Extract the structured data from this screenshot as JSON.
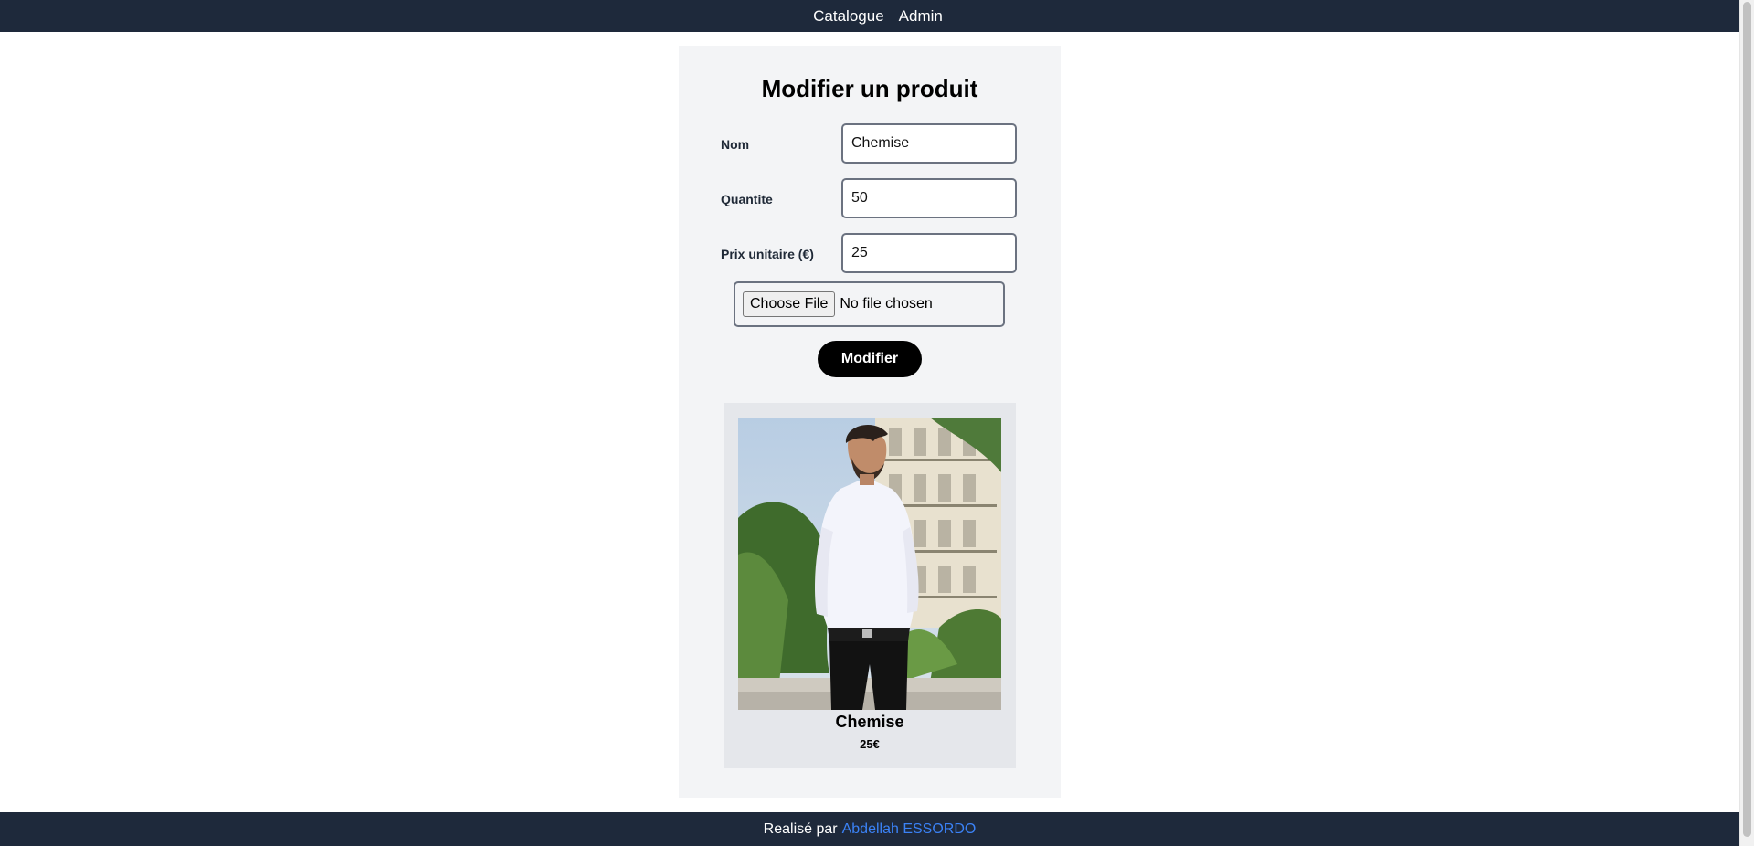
{
  "nav": {
    "items": [
      {
        "label": "Catalogue"
      },
      {
        "label": "Admin"
      }
    ]
  },
  "form": {
    "title": "Modifier un produit",
    "fields": [
      {
        "label": "Nom",
        "value": "Chemise"
      },
      {
        "label": "Quantite",
        "value": "50"
      },
      {
        "label": "Prix unitaire (€)",
        "value": "25"
      }
    ],
    "file_input": {
      "button_label": "Choose File",
      "status": "No file chosen"
    },
    "submit_label": "Modifier"
  },
  "preview": {
    "image_icon": "product-photo-shirt",
    "name": "Chemise",
    "price": "25€"
  },
  "footer": {
    "prefix": "Realisé par",
    "author": "Abdellah ESSORDO"
  },
  "colors": {
    "header_bg": "#1e293b",
    "card_bg": "#f3f4f6",
    "preview_bg": "#e5e7eb",
    "button_bg": "#000000",
    "link": "#3b82f6"
  }
}
